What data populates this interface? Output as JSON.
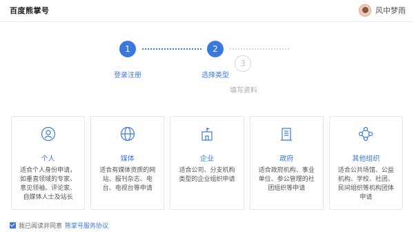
{
  "header": {
    "logo": "百度熊掌号",
    "username": "风中梦雨"
  },
  "steps": [
    {
      "number": "1",
      "label": "登录注册",
      "state": "done"
    },
    {
      "number": "2",
      "label": "选择类型",
      "state": "current"
    },
    {
      "number": "3",
      "label": "填写资料",
      "state": "pending"
    }
  ],
  "cards": [
    {
      "title": "个人",
      "icon": "user-icon",
      "desc": "适合个人身份申请，如垂直领域的专家、意见领袖、评论家、自媒体人士及站长"
    },
    {
      "title": "媒体",
      "icon": "globe-icon",
      "desc": "适合有媒体资质的网站、报刊杂志、电台、电视台等申请"
    },
    {
      "title": "企业",
      "icon": "enterprise-icon",
      "desc": "适合公司、分支机构类型的企业组织申请"
    },
    {
      "title": "政府",
      "icon": "government-icon",
      "desc": "适合政府机构、事业单位、参公管理的社团组织等申请"
    },
    {
      "title": "其他组织",
      "icon": "network-icon",
      "desc": "适合公共场馆、公益机构、学校、社团、民间组织等机构团体申请"
    }
  ],
  "agreement": {
    "prefix": "我已阅读并同意",
    "link": "熊掌号服务协议",
    "checked": true
  },
  "colors": {
    "accent": "#3a78e0",
    "inactive": "#c0c0c0"
  }
}
